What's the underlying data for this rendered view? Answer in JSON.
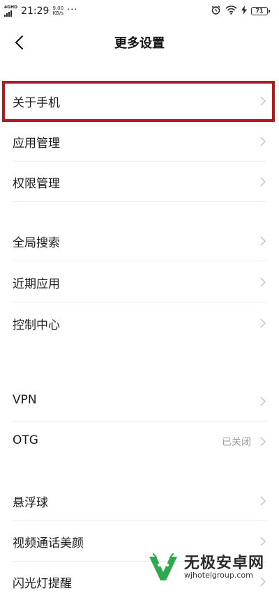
{
  "status_bar": {
    "network_type": "4GHD",
    "time": "21:29",
    "speed_value": "9.00",
    "speed_unit": "KB/s",
    "more": "···",
    "battery": "71"
  },
  "header": {
    "title": "更多设置"
  },
  "items": [
    {
      "label": "关于手机"
    },
    {
      "label": "应用管理"
    },
    {
      "label": "权限管理"
    },
    {
      "label": "全局搜索"
    },
    {
      "label": "近期应用"
    },
    {
      "label": "控制中心"
    },
    {
      "label": "VPN"
    },
    {
      "label": "OTG",
      "value": "已关闭"
    },
    {
      "label": "悬浮球"
    },
    {
      "label": "视频通话美颜"
    },
    {
      "label": "闪光灯提醒"
    }
  ],
  "watermark": {
    "name": "无极安卓网",
    "url": "wjhotelgroup.com"
  },
  "colors": {
    "highlight": "#b3191f",
    "chevron": "#c8c8c8",
    "secondary_text": "#9a9a9a",
    "logo_green": "#2fa84f"
  }
}
